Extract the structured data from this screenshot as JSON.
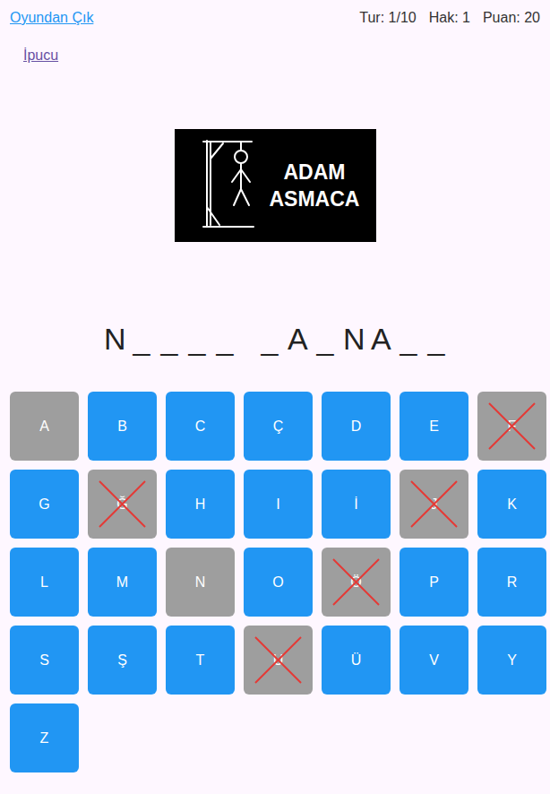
{
  "top_bar": {
    "exit_link": "Oyundan Çık",
    "stats": [
      {
        "label": "Tur: 1/10"
      },
      {
        "label": "Hak: 1"
      },
      {
        "label": "Puan: 20"
      }
    ]
  },
  "hint_link": "İpucu",
  "logo": {
    "lines": [
      "ADAM",
      "ASMACA"
    ]
  },
  "word": [
    {
      "letters": [
        "N",
        "_",
        "_",
        "_",
        "_"
      ]
    },
    {
      "letters": [
        "_",
        "A",
        "_",
        "N",
        "A",
        "_",
        "_"
      ]
    }
  ],
  "keys": [
    {
      "label": "A",
      "used": true,
      "wrong": false
    },
    {
      "label": "B",
      "used": false,
      "wrong": false
    },
    {
      "label": "C",
      "used": false,
      "wrong": false
    },
    {
      "label": "Ç",
      "used": false,
      "wrong": false
    },
    {
      "label": "D",
      "used": false,
      "wrong": false
    },
    {
      "label": "E",
      "used": false,
      "wrong": false
    },
    {
      "label": "F",
      "used": true,
      "wrong": true
    },
    {
      "label": "G",
      "used": false,
      "wrong": false
    },
    {
      "label": "Ğ",
      "used": true,
      "wrong": true
    },
    {
      "label": "H",
      "used": false,
      "wrong": false
    },
    {
      "label": "I",
      "used": false,
      "wrong": false
    },
    {
      "label": "İ",
      "used": false,
      "wrong": false
    },
    {
      "label": "J",
      "used": true,
      "wrong": true
    },
    {
      "label": "K",
      "used": false,
      "wrong": false
    },
    {
      "label": "L",
      "used": false,
      "wrong": false
    },
    {
      "label": "M",
      "used": false,
      "wrong": false
    },
    {
      "label": "N",
      "used": true,
      "wrong": false
    },
    {
      "label": "O",
      "used": false,
      "wrong": false
    },
    {
      "label": "Ö",
      "used": true,
      "wrong": true
    },
    {
      "label": "P",
      "used": false,
      "wrong": false
    },
    {
      "label": "R",
      "used": false,
      "wrong": false
    },
    {
      "label": "S",
      "used": false,
      "wrong": false
    },
    {
      "label": "Ş",
      "used": false,
      "wrong": false
    },
    {
      "label": "T",
      "used": false,
      "wrong": false
    },
    {
      "label": "U",
      "used": true,
      "wrong": true
    },
    {
      "label": "Ü",
      "used": false,
      "wrong": false
    },
    {
      "label": "V",
      "used": false,
      "wrong": false
    },
    {
      "label": "Y",
      "used": false,
      "wrong": false
    },
    {
      "label": "Z",
      "used": false,
      "wrong": false
    }
  ]
}
